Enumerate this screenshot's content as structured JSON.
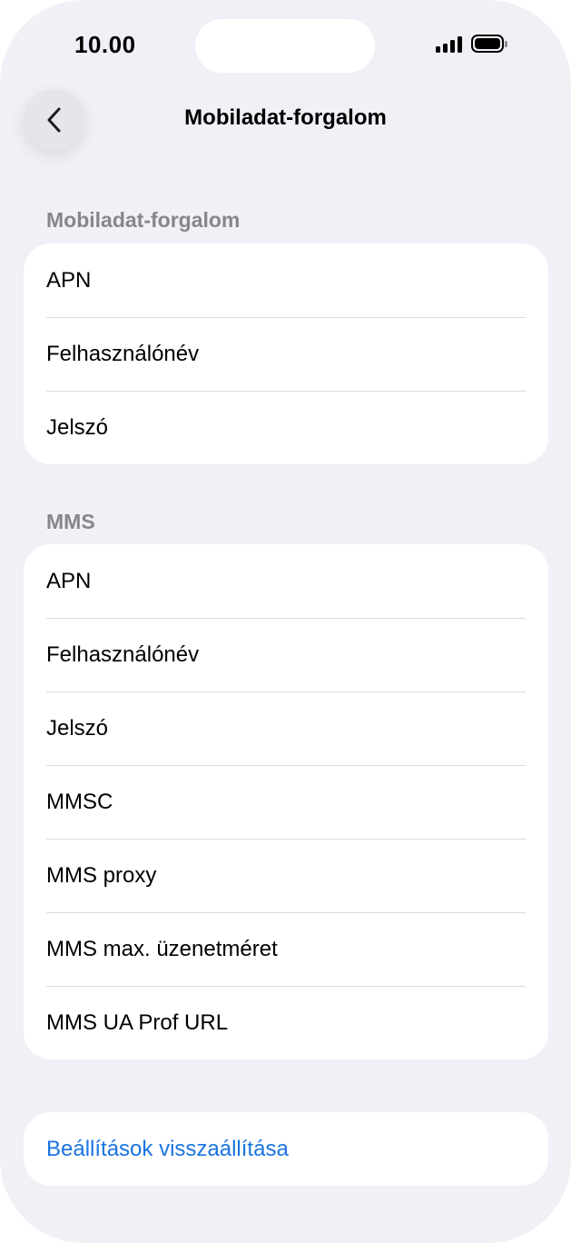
{
  "status_bar": {
    "time": "10.00"
  },
  "nav": {
    "title": "Mobiladat-forgalom",
    "back_icon": "chevron-left-icon"
  },
  "sections": [
    {
      "header": "Mobiladat-forgalom",
      "rows": [
        "APN",
        "Felhasználónév",
        "Jelszó"
      ]
    },
    {
      "header": "MMS",
      "rows": [
        "APN",
        "Felhasználónév",
        "Jelszó",
        "MMSC",
        "MMS proxy",
        "MMS max. üzenetméret",
        "MMS UA Prof URL"
      ]
    }
  ],
  "reset": {
    "label": "Beállítások visszaállítása"
  },
  "colors": {
    "background": "#f1f0f6",
    "card": "#ffffff",
    "link": "#1a74e0",
    "section_header": "#86868b"
  }
}
